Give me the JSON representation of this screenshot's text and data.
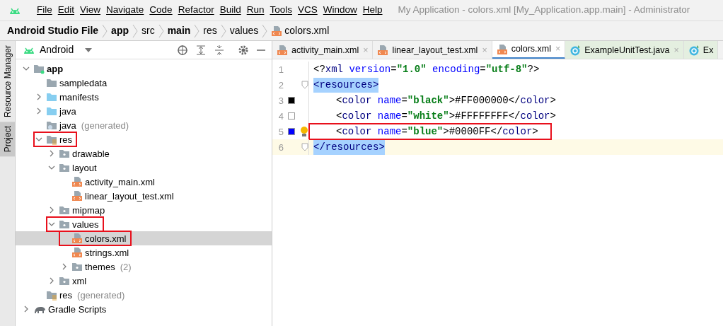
{
  "menu_bar": {
    "items": [
      "File",
      "Edit",
      "View",
      "Navigate",
      "Code",
      "Refactor",
      "Build",
      "Run",
      "Tools",
      "VCS",
      "Window",
      "Help"
    ],
    "title": "My Application - colors.xml [My_Application.app.main] - Administrator"
  },
  "breadcrumbs": [
    {
      "label": "Android Studio File",
      "bold": true
    },
    {
      "label": "app",
      "bold": true
    },
    {
      "label": "src",
      "bold": false
    },
    {
      "label": "main",
      "bold": true
    },
    {
      "label": "res",
      "bold": false
    },
    {
      "label": "values",
      "bold": false
    },
    {
      "label": "colors.xml",
      "bold": false,
      "kind": "xml"
    }
  ],
  "side_strip": [
    {
      "label": "Resource Manager",
      "selected": false
    },
    {
      "label": "Project",
      "selected": true
    }
  ],
  "project_panel": {
    "view": "Android",
    "tree": [
      {
        "label": "app",
        "kind": "module",
        "expanded": true,
        "selected": false,
        "annotated": false,
        "children": [
          {
            "label": "sampledata",
            "kind": "folder",
            "selected": false,
            "annotated": false
          },
          {
            "label": "manifests",
            "kind": "source",
            "expanded": false,
            "selected": false,
            "annotated": false
          },
          {
            "label": "java",
            "kind": "source",
            "expanded": false,
            "selected": false,
            "annotated": false
          },
          {
            "label": "java",
            "note": "(generated)",
            "kind": "generated",
            "selected": false,
            "annotated": false
          },
          {
            "label": "res",
            "kind": "resources",
            "expanded": true,
            "selected": false,
            "annotated": true,
            "children": [
              {
                "label": "drawable",
                "kind": "package",
                "expanded": false,
                "selected": false,
                "annotated": false
              },
              {
                "label": "layout",
                "kind": "package",
                "expanded": true,
                "selected": false,
                "annotated": false,
                "children": [
                  {
                    "label": "activity_main.xml",
                    "kind": "xml",
                    "selected": false,
                    "annotated": false
                  },
                  {
                    "label": "linear_layout_test.xml",
                    "kind": "xml",
                    "selected": false,
                    "annotated": false
                  }
                ]
              },
              {
                "label": "mipmap",
                "kind": "package",
                "expanded": false,
                "selected": false,
                "annotated": false
              },
              {
                "label": "values",
                "kind": "package",
                "expanded": true,
                "selected": false,
                "annotated": true,
                "children": [
                  {
                    "label": "colors.xml",
                    "kind": "xml",
                    "selected": true,
                    "annotated": true
                  },
                  {
                    "label": "strings.xml",
                    "kind": "xml",
                    "selected": false,
                    "annotated": false
                  },
                  {
                    "label": "themes",
                    "note": "(2)",
                    "kind": "package",
                    "expanded": false,
                    "selected": false,
                    "annotated": false
                  }
                ]
              },
              {
                "label": "xml",
                "kind": "package",
                "expanded": false,
                "selected": false,
                "annotated": false
              }
            ]
          },
          {
            "label": "res",
            "note": "(generated)",
            "kind": "resources",
            "selected": false,
            "annotated": false
          }
        ]
      },
      {
        "label": "Gradle Scripts",
        "kind": "gradle",
        "expanded": false,
        "selected": false,
        "annotated": false
      }
    ]
  },
  "editor_tabs": [
    {
      "label": "activity_main.xml",
      "kind": "xml",
      "close": "×",
      "selected": false
    },
    {
      "label": "linear_layout_test.xml",
      "kind": "xml",
      "close": "×",
      "selected": false
    },
    {
      "label": "colors.xml",
      "kind": "xml",
      "close": "×",
      "selected": true
    },
    {
      "label": "ExampleUnitTest.java",
      "kind": "java",
      "close": "×",
      "selected": false
    },
    {
      "label": "Ex",
      "kind": "java",
      "selected": false
    }
  ],
  "code_lines": [
    {
      "number": "1",
      "current": false,
      "annotated": false,
      "nested": false,
      "tokens": [
        {
          "kind": "punct",
          "text": "<?"
        },
        {
          "kind": "tag",
          "text": "xml"
        },
        {
          "kind": "attr",
          "text": " version"
        },
        {
          "kind": "punct",
          "text": "="
        },
        {
          "kind": "str",
          "text": "\"1.0\""
        },
        {
          "kind": "attr",
          "text": " encoding"
        },
        {
          "kind": "punct",
          "text": "="
        },
        {
          "kind": "str",
          "text": "\"utf-8\""
        },
        {
          "kind": "punct",
          "text": "?>"
        }
      ]
    },
    {
      "number": "2",
      "current": false,
      "annotated": false,
      "nested": false,
      "fold": true,
      "tokens": [
        {
          "kind": "match",
          "text": "<resources>"
        }
      ]
    },
    {
      "number": "3",
      "current": false,
      "annotated": false,
      "nested": true,
      "color": "#000000",
      "tokens": [
        {
          "kind": "punct",
          "text": "<"
        },
        {
          "kind": "tag",
          "text": "color"
        },
        {
          "kind": "attr",
          "text": " name"
        },
        {
          "kind": "punct",
          "text": "="
        },
        {
          "kind": "str",
          "text": "\"black\""
        },
        {
          "kind": "punct",
          "text": ">"
        },
        {
          "kind": "text",
          "text": "#FF000000"
        },
        {
          "kind": "punct",
          "text": "</"
        },
        {
          "kind": "tag",
          "text": "color"
        },
        {
          "kind": "punct",
          "text": ">"
        }
      ]
    },
    {
      "number": "4",
      "current": false,
      "annotated": false,
      "nested": true,
      "color": "#ffffff",
      "tokens": [
        {
          "kind": "punct",
          "text": "<"
        },
        {
          "kind": "tag",
          "text": "color"
        },
        {
          "kind": "attr",
          "text": " name"
        },
        {
          "kind": "punct",
          "text": "="
        },
        {
          "kind": "str",
          "text": "\"white\""
        },
        {
          "kind": "punct",
          "text": ">"
        },
        {
          "kind": "text",
          "text": "#FFFFFFFF"
        },
        {
          "kind": "punct",
          "text": "</"
        },
        {
          "kind": "tag",
          "text": "color"
        },
        {
          "kind": "punct",
          "text": ">"
        }
      ]
    },
    {
      "number": "5",
      "current": false,
      "annotated": true,
      "nested": true,
      "bulb": true,
      "color": "#0000ff",
      "tokens": [
        {
          "kind": "punct",
          "text": "<"
        },
        {
          "kind": "tag",
          "text": "color"
        },
        {
          "kind": "attr",
          "text": " name"
        },
        {
          "kind": "punct",
          "text": "="
        },
        {
          "kind": "str",
          "text": "\"blue\""
        },
        {
          "kind": "punct",
          "text": ">"
        },
        {
          "kind": "text",
          "text": "#0000FF"
        },
        {
          "kind": "punct",
          "text": "</"
        },
        {
          "kind": "tag",
          "text": "color"
        },
        {
          "kind": "punct",
          "text": ">"
        }
      ]
    },
    {
      "number": "6",
      "current": true,
      "annotated": false,
      "nested": false,
      "fold": true,
      "tokens": [
        {
          "kind": "match",
          "text": "</resources>"
        }
      ]
    }
  ]
}
